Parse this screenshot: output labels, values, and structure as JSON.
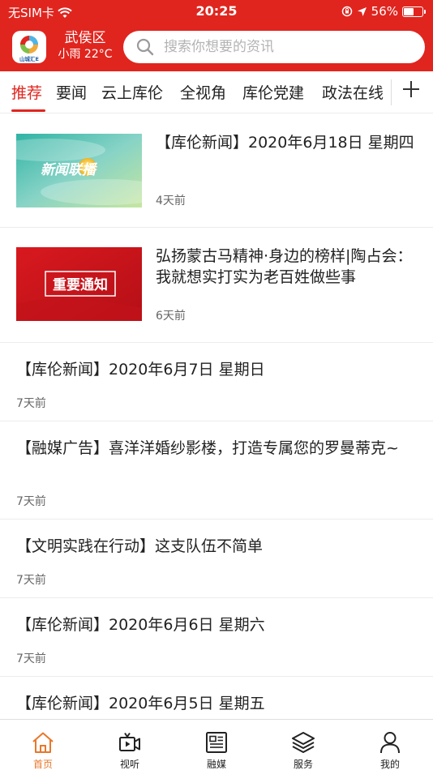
{
  "status_bar": {
    "carrier": "无SIM卡",
    "time": "20:25",
    "battery_text": "56%",
    "battery_level": 0.56
  },
  "header": {
    "logo_text": "山城汇E",
    "location": "武侯区",
    "weather": "小雨 22°C",
    "search_placeholder": "搜索你想要的资讯",
    "accent_color": "#e0251f"
  },
  "tabs": [
    "推荐",
    "要闻",
    "云上库伦",
    "全视角",
    "库伦党建",
    "政法在线"
  ],
  "active_tab": "推荐",
  "feed": [
    {
      "title": "【库伦新闻】2020年6月18日 星期四",
      "time": "4天前",
      "thumb": "news-broadcast",
      "thumb_text": "新闻联播"
    },
    {
      "title": "弘扬蒙古马精神·身边的榜样|陶占会：我就想实打实为老百姓做些事",
      "time": "6天前",
      "thumb": "important-notice",
      "thumb_text": "重要通知"
    },
    {
      "title": "【库伦新闻】2020年6月7日 星期日",
      "time": "7天前"
    },
    {
      "title": "【融媒广告】喜洋洋婚纱影楼，打造专属您的罗曼蒂克~",
      "time": "7天前"
    },
    {
      "title": "【文明实践在行动】这支队伍不简单",
      "time": "7天前"
    },
    {
      "title": "【库伦新闻】2020年6月6日 星期六",
      "time": "7天前"
    },
    {
      "title": "【库伦新闻】2020年6月5日 星期五",
      "time": ""
    }
  ],
  "bottom_nav": [
    {
      "label": "首页",
      "icon": "home-icon"
    },
    {
      "label": "视听",
      "icon": "video-icon"
    },
    {
      "label": "融媒",
      "icon": "newspaper-icon"
    },
    {
      "label": "服务",
      "icon": "layers-icon"
    },
    {
      "label": "我的",
      "icon": "user-icon"
    }
  ],
  "active_nav": "首页"
}
